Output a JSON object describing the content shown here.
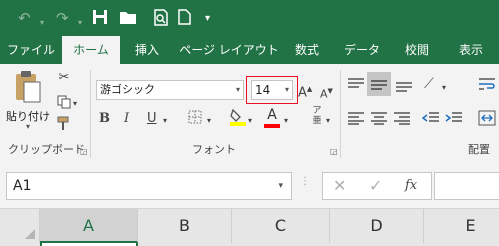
{
  "colors": {
    "excel_green": "#217346",
    "highlight_yellow": "#ffff00",
    "font_red": "#ff0000",
    "selection_red": "#e81123"
  },
  "qat": {
    "undo_icon": "undo-icon",
    "redo_icon": "redo-icon",
    "save_icon": "save-icon",
    "open_icon": "folder-icon",
    "preview_icon": "print-preview-icon",
    "new_icon": "new-document-icon",
    "customize_icon": "customize-qat-icon"
  },
  "tabs": [
    {
      "label": "ファイル"
    },
    {
      "label": "ホーム",
      "active": true
    },
    {
      "label": "挿入"
    },
    {
      "label": "ページ レイアウト"
    },
    {
      "label": "数式"
    },
    {
      "label": "データ"
    },
    {
      "label": "校閲"
    },
    {
      "label": "表示"
    }
  ],
  "clipboard": {
    "paste_label": "貼り付け",
    "group_label": "クリップボード"
  },
  "font": {
    "name": "游ゴシック",
    "size": "14",
    "group_label": "フォント",
    "bold": "B",
    "italic": "I",
    "underline": "U",
    "font_color_letter": "A",
    "phonetic_char": "ア",
    "phonetic_sub": "亜"
  },
  "alignment": {
    "group_label": "配置"
  },
  "formula_bar": {
    "name_box": "A1",
    "fx": "fx"
  },
  "columns": [
    "A",
    "B",
    "C",
    "D",
    "E"
  ]
}
